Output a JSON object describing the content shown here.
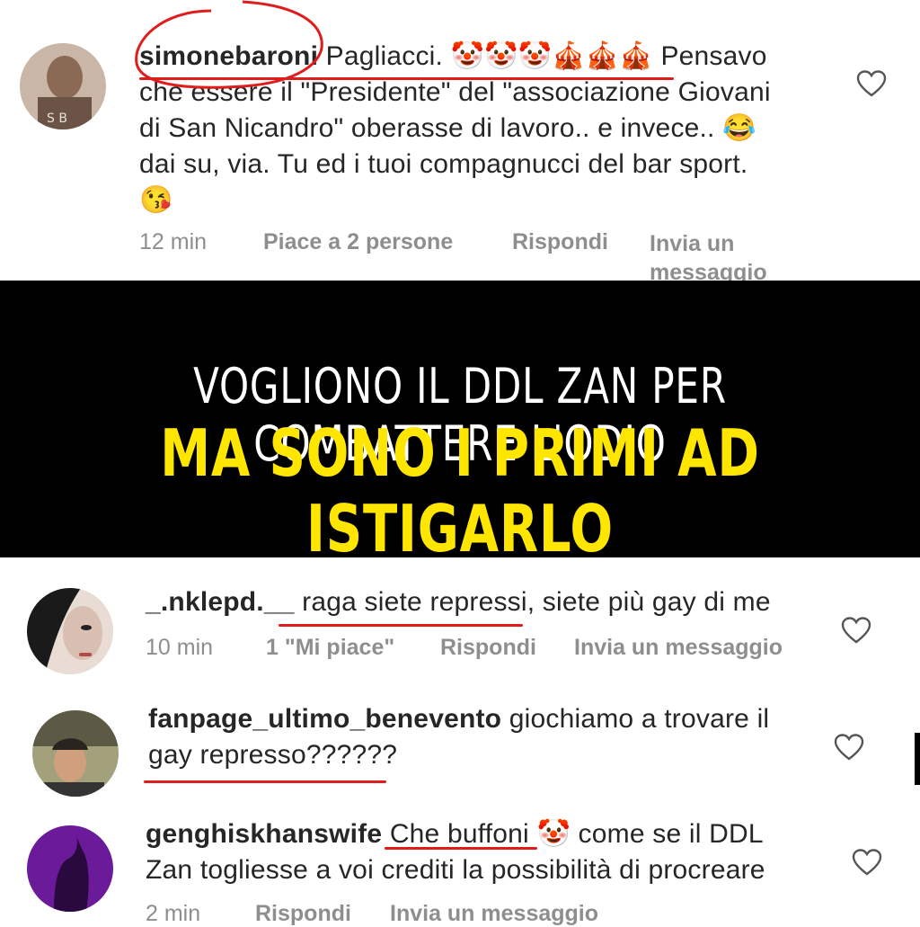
{
  "comments": [
    {
      "username": "simonebaroni",
      "text_line1": "Pagliacci. 🤡🤡🤡🎪🎪🎪 Pensavo",
      "text_line2": "che essere il \"Presidente\" del \"associazione Giovani",
      "text_line3": "di San Nicandro\" oberasse di lavoro.. e invece.. 😂",
      "text_line4": "dai su, via. Tu ed i tuoi compagnucci del bar sport.",
      "text_line5": "😘",
      "time": "12 min",
      "likes": "Piace a 2 persone",
      "reply": "Rispondi",
      "message_line1": "Invia un",
      "message_line2": "messaggio"
    },
    {
      "username": "_.nklepd.__",
      "text": "raga siete repressi, siete più gay di me",
      "time": "10 min",
      "likes": "1 \"Mi piace\"",
      "reply": "Rispondi",
      "message": "Invia un messaggio"
    },
    {
      "username": "fanpage_ultimo_benevento",
      "text_line1": "giochiamo a trovare il",
      "text_line2": "gay represso??????"
    },
    {
      "username": "genghiskhanswife",
      "text_highlight": "Che buffoni",
      "text_line1_rest": "🤡 come se il DDL",
      "text_line2": "Zan togliesse a voi crediti la possibilità di procreare",
      "time": "2 min",
      "reply": "Rispondi",
      "message": "Invia un messaggio"
    }
  ],
  "banner": {
    "line1": "VOGLIONO IL DDL ZAN PER COMBATTERE L'ODIO",
    "line2": "MA SONO I PRIMI AD ISTIGARLO"
  },
  "colors": {
    "annotation_red": "#e01d1d",
    "banner_yellow": "#ffe600",
    "banner_bg": "#000000",
    "meta_gray": "#8e8e8e"
  },
  "icons": [
    "heart-icon",
    "avatar"
  ]
}
